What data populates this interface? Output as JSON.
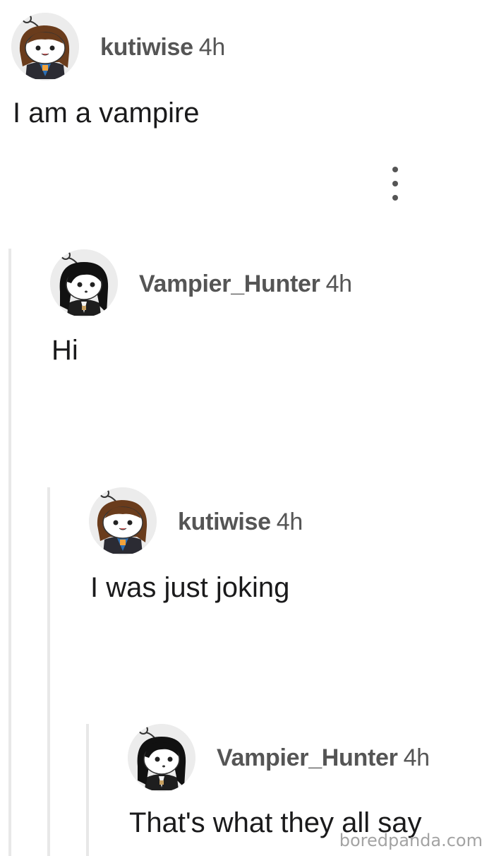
{
  "comments": [
    {
      "username": "kutiwise",
      "time": "4h",
      "body": "I am a vampire",
      "avatar": "snoo-brown-hair-avatar"
    },
    {
      "username": "Vampier_Hunter",
      "time": "4h",
      "body": "Hi",
      "avatar": "snoo-black-hair-avatar"
    },
    {
      "username": "kutiwise",
      "time": "4h",
      "body": "I was just joking",
      "avatar": "snoo-brown-hair-avatar"
    },
    {
      "username": "Vampier_Hunter",
      "time": "4h",
      "body": "That's what they all say",
      "avatar": "snoo-black-hair-avatar"
    }
  ],
  "more_options_icon": "vertical-ellipsis-icon",
  "watermark": "boredpanda.com",
  "colors": {
    "username": "#555555",
    "body_text": "#1a1a1b",
    "thread_line": "#e8e8e8",
    "avatar_bg": "#ececec"
  }
}
